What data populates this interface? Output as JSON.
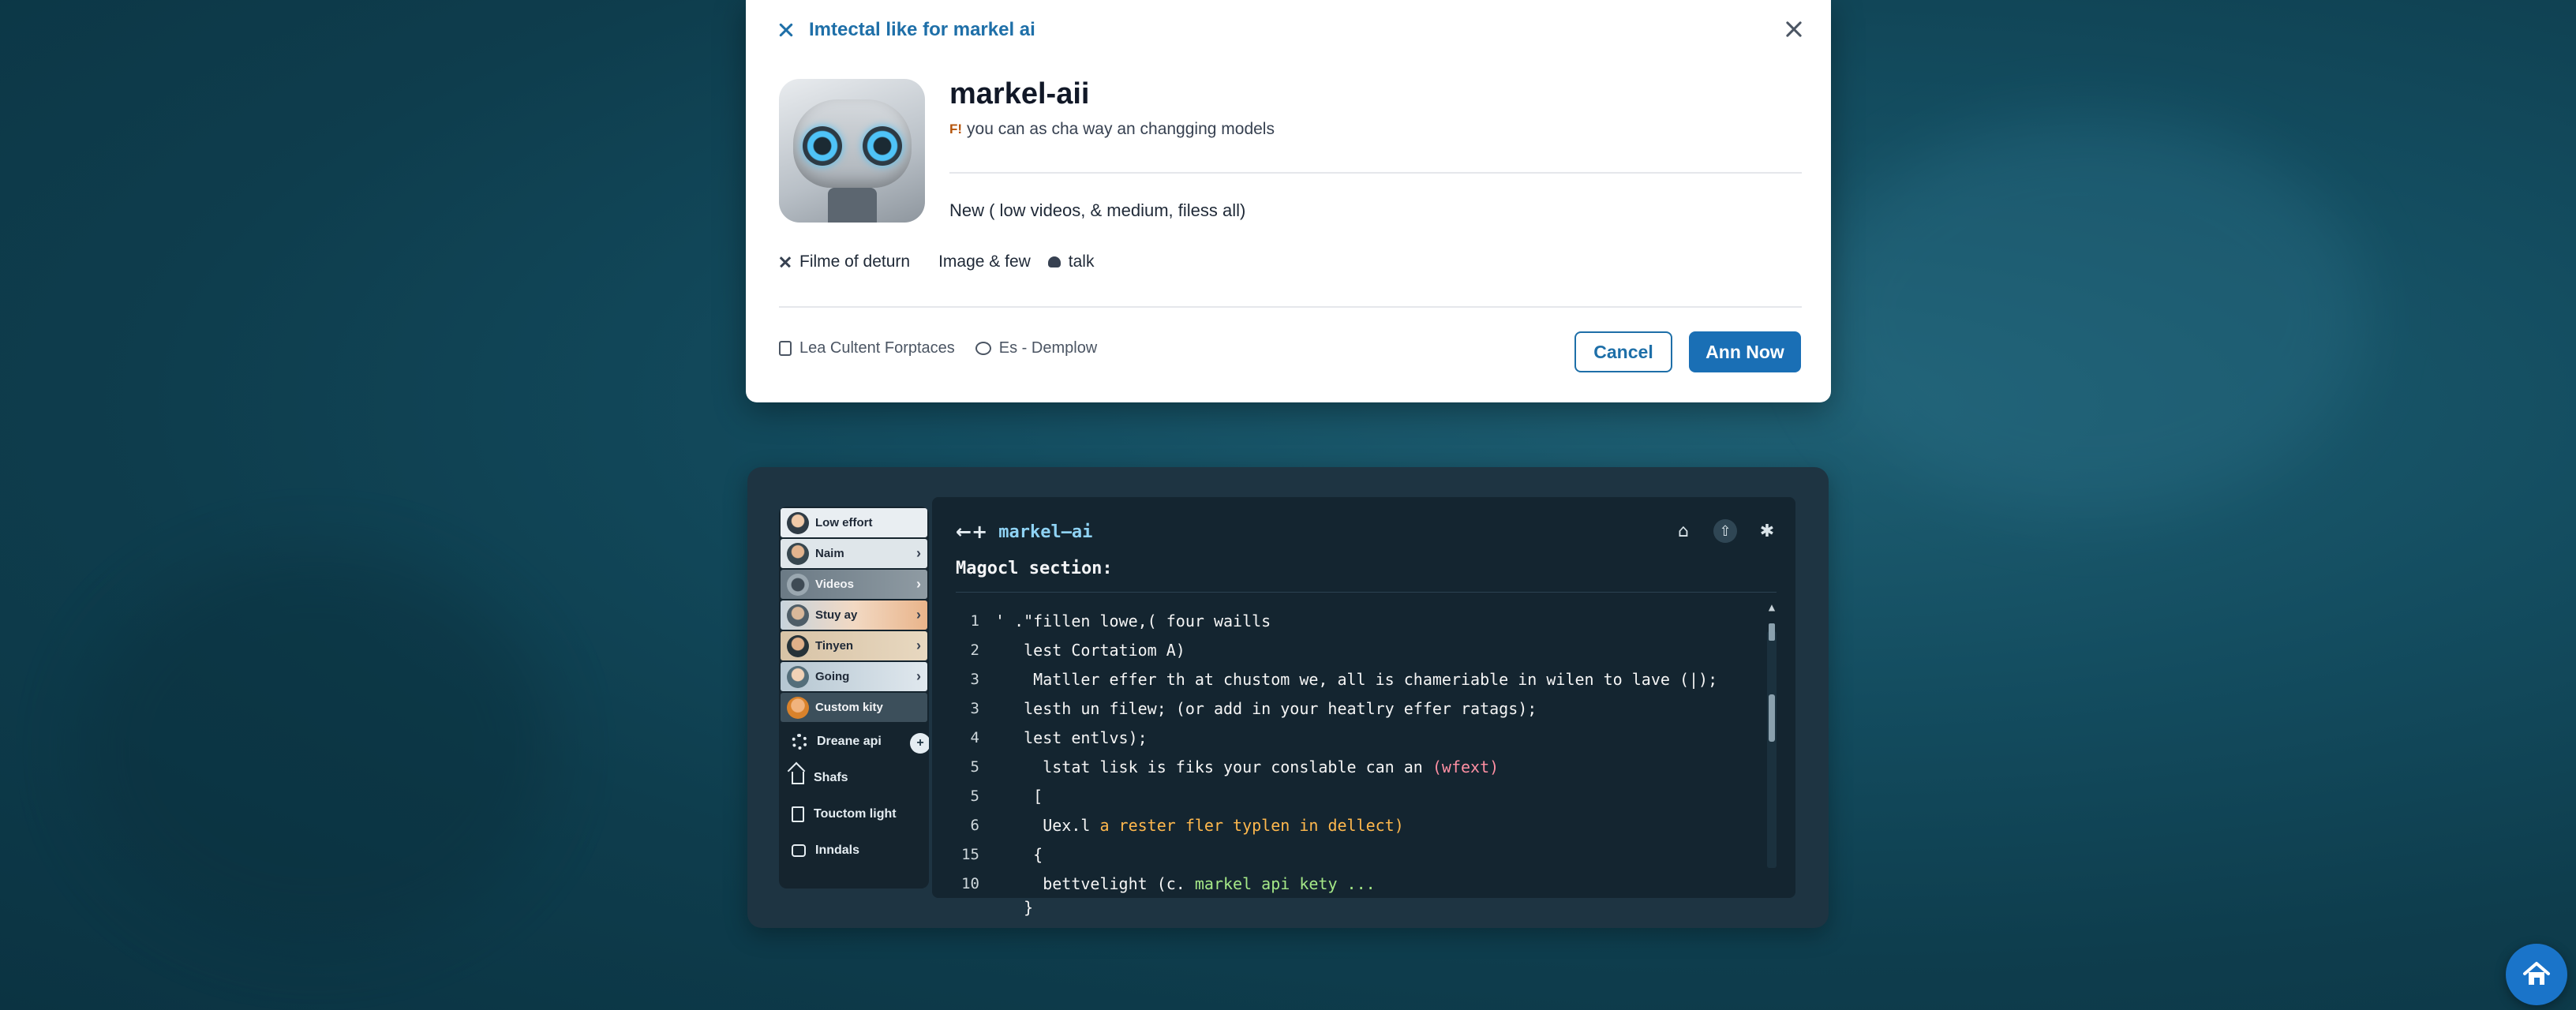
{
  "modal": {
    "title": "Imtectal like for markel ai",
    "app_name": "markel-aii",
    "tag_badge": "F!",
    "tagline": "you can as cha way an changging models",
    "features": "New ( low videos, & medium, filess all)",
    "meta": [
      {
        "icon": "close-icon",
        "label": "Filme of deturn"
      },
      {
        "icon": "",
        "label": "Image & few"
      },
      {
        "icon": "chat-icon",
        "label": "talk"
      }
    ],
    "footer": {
      "item1": "Lea Cultent Forptaces",
      "item2": "Es - Demplow"
    },
    "cancel_label": "Cancel",
    "primary_label": "Ann Now"
  },
  "sidebar": {
    "items": [
      {
        "label": "Low effort"
      },
      {
        "label": "Naim"
      },
      {
        "label": "Videos"
      },
      {
        "label": "Stuy ay"
      },
      {
        "label": "Tinyen"
      },
      {
        "label": "Going"
      },
      {
        "label": "Custom kity"
      }
    ],
    "menu": [
      {
        "icon": "gear-icon",
        "label": "Dreane api"
      },
      {
        "icon": "home-icon",
        "label": "Shafs"
      },
      {
        "icon": "document-icon",
        "label": "Touctom light"
      },
      {
        "icon": "box-icon",
        "label": "Inndals"
      }
    ],
    "plus_label": "+"
  },
  "editor": {
    "back": "←+",
    "title": "markel–ai",
    "section": "Magocl section:",
    "lines": [
      {
        "n": "1",
        "text": "' .\"fillen lowe,( four waills"
      },
      {
        "n": "2",
        "text": "   lest Cortatiom A)"
      },
      {
        "n": "3",
        "text": "    Matller effer th at chustom we, all is chameriable in wilen to lave (|);"
      },
      {
        "n": "3",
        "text": "   lesth un filew; (or add in your heatlry effer ratags);"
      },
      {
        "n": "4",
        "text": "   lest entlvs);"
      },
      {
        "n": "5",
        "text": "     lstat lisk is fiks your conslable can an ",
        "pink": "(wfext)"
      },
      {
        "n": "5",
        "text": "    [ "
      },
      {
        "n": "6",
        "text": "     Uex.l ",
        "orange": "a rester fler typlen in dellect)"
      },
      {
        "n": "15",
        "text": "    {"
      },
      {
        "n": "10",
        "text": "     bettvelight (c. ",
        "green": "markel api kety ..."
      },
      {
        "n": "",
        "text": "   }"
      }
    ]
  },
  "colors": {
    "accent": "#1e6fa8",
    "primary_button": "#1a6fb5",
    "editor_bg": "#142530",
    "panel_bg": "#1e3442"
  }
}
